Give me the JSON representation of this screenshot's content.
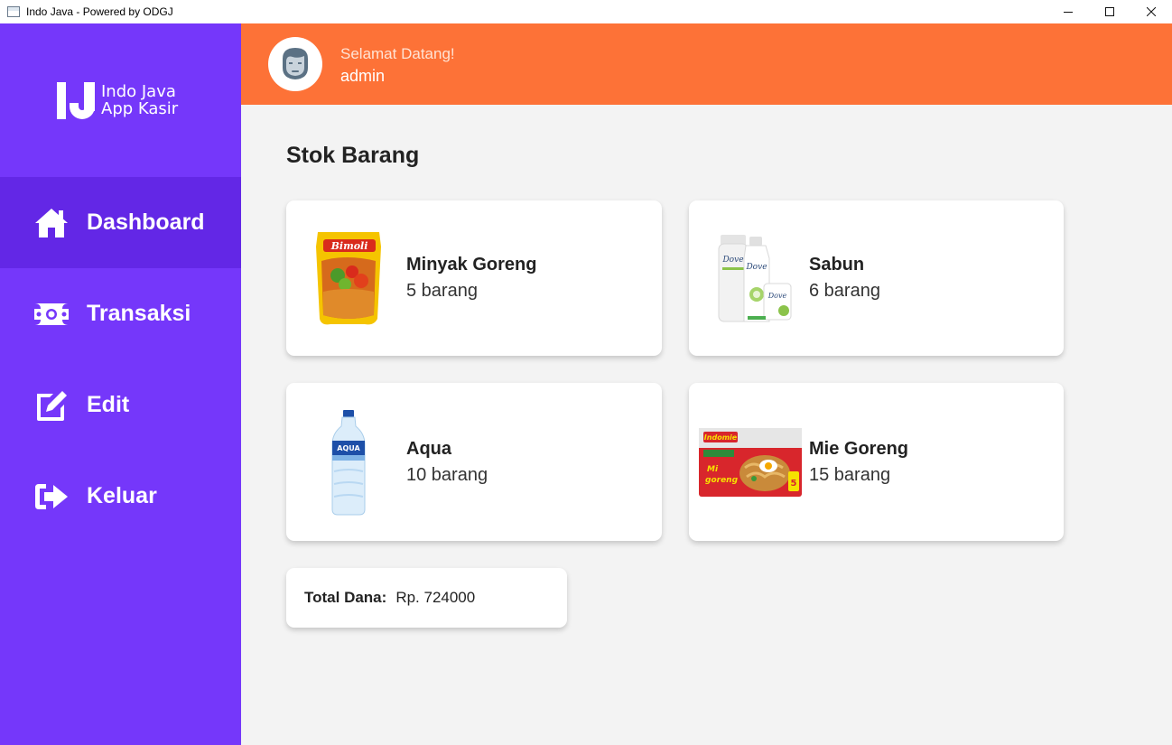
{
  "window": {
    "title": "Indo Java - Powered by ODGJ"
  },
  "logo": {
    "line1": "Indo Java",
    "line2": "App Kasir"
  },
  "sidebar": {
    "items": [
      {
        "label": "Dashboard",
        "icon": "home-icon",
        "active": true
      },
      {
        "label": "Transaksi",
        "icon": "money-icon",
        "active": false
      },
      {
        "label": "Edit",
        "icon": "edit-icon",
        "active": false
      },
      {
        "label": "Keluar",
        "icon": "logout-icon",
        "active": false
      }
    ]
  },
  "header": {
    "welcome": "Selamat Datang!",
    "username": "admin",
    "avatar_icon": "user-avatar-icon"
  },
  "main": {
    "title": "Stok Barang",
    "products": [
      {
        "name": "Minyak Goreng",
        "qty": "5 barang",
        "image": "cooking-oil-image"
      },
      {
        "name": "Sabun",
        "qty": "6 barang",
        "image": "soap-image"
      },
      {
        "name": "Aqua",
        "qty": "10 barang",
        "image": "water-bottle-image"
      },
      {
        "name": "Mie Goreng",
        "qty": "15 barang",
        "image": "instant-noodle-image"
      }
    ],
    "total": {
      "label": "Total Dana:",
      "value": "Rp. 724000"
    }
  },
  "colors": {
    "sidebar": "#7537fa",
    "sidebar_active": "#6327e6",
    "header": "#fd7237",
    "background": "#f3f3f3"
  }
}
